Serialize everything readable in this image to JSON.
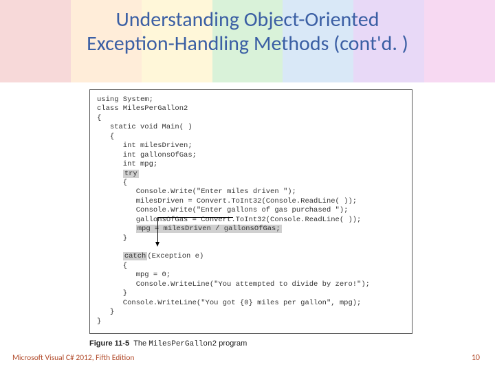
{
  "title_line1": "Understanding Object-Oriented",
  "title_line2": "Exception-Handling Methods (cont'd. )",
  "code": {
    "l01": "using System;",
    "l02": "class MilesPerGallon2",
    "l03": "{",
    "l04": "   static void Main( )",
    "l05": "   {",
    "l06": "      int milesDriven;",
    "l07": "      int gallonsOfGas;",
    "l08": "      int mpg;",
    "kw_try": "try",
    "l10": "      {",
    "l11": "         Console.Write(\"Enter miles driven \");",
    "l12": "         milesDriven = Convert.ToInt32(Console.ReadLine( ));",
    "l13": "         Console.Write(\"Enter gallons of gas purchased \");",
    "l14": "         gallonsOfGas = Convert.ToInt32(Console.ReadLine( ));",
    "hl_mpg": "mpg = milesDriven / gallonsOfGas;",
    "l16": "      }",
    "kw_catch": "catch",
    "catch_rest": "(Exception e)",
    "l19": "      {",
    "l20": "         mpg = 0;",
    "l21": "         Console.WriteLine(\"You attempted to divide by zero!\");",
    "l22": "      }",
    "l23": "      Console.WriteLine(\"You got {0} miles per gallon\", mpg);",
    "l24": "   }",
    "l25": "}"
  },
  "caption_label": "Figure 11-5",
  "caption_pre": "The ",
  "caption_code": "MilesPerGallon2",
  "caption_post": " program",
  "footer_left": "Microsoft Visual C# 2012, Fifth Edition",
  "footer_right": "10"
}
